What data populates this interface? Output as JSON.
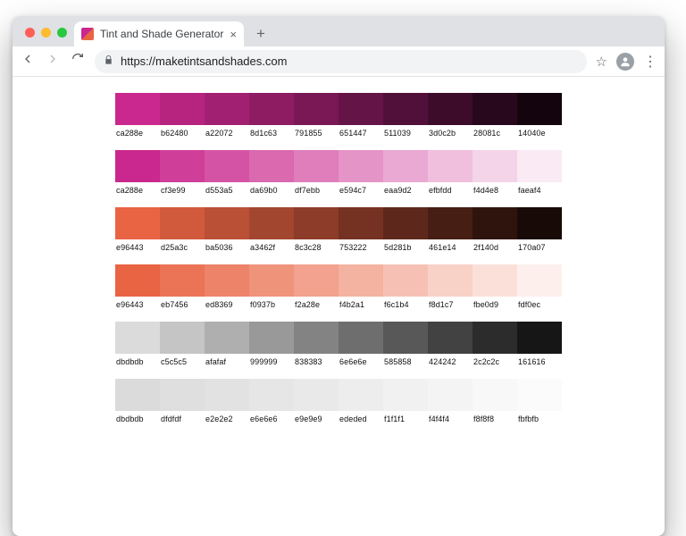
{
  "window": {
    "traffic": {
      "close": "#ff5f57",
      "min": "#febc2e",
      "max": "#28c840"
    },
    "tab_title": "Tint and Shade Generator",
    "close_glyph": "×",
    "newtab_glyph": "+"
  },
  "toolbar": {
    "url": "https://maketintsandshades.com",
    "star_glyph": "☆",
    "menu_glyph": "⋮"
  },
  "rows": [
    {
      "hex": [
        "ca288e",
        "b62480",
        "a22072",
        "8d1c63",
        "791855",
        "651447",
        "511039",
        "3d0c2b",
        "28081c",
        "14040e"
      ]
    },
    {
      "hex": [
        "ca288e",
        "cf3e99",
        "d553a5",
        "da69b0",
        "df7ebb",
        "e594c7",
        "eaa9d2",
        "efbfdd",
        "f4d4e8",
        "faeaf4"
      ]
    },
    {
      "hex": [
        "e96443",
        "d25a3c",
        "ba5036",
        "a3462f",
        "8c3c28",
        "753222",
        "5d281b",
        "461e14",
        "2f140d",
        "170a07"
      ]
    },
    {
      "hex": [
        "e96443",
        "eb7456",
        "ed8369",
        "f0937b",
        "f2a28e",
        "f4b2a1",
        "f6c1b4",
        "f8d1c7",
        "fbe0d9",
        "fdf0ec"
      ]
    },
    {
      "hex": [
        "dbdbdb",
        "c5c5c5",
        "afafaf",
        "999999",
        "838383",
        "6e6e6e",
        "585858",
        "424242",
        "2c2c2c",
        "161616"
      ]
    },
    {
      "hex": [
        "dbdbdb",
        "dfdfdf",
        "e2e2e2",
        "e6e6e6",
        "e9e9e9",
        "ededed",
        "f1f1f1",
        "f4f4f4",
        "f8f8f8",
        "fbfbfb"
      ]
    }
  ]
}
